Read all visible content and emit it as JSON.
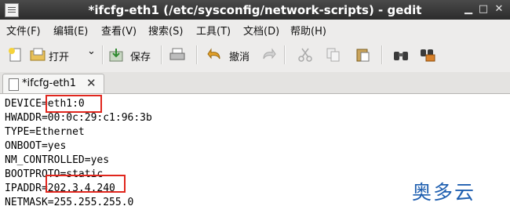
{
  "window": {
    "title": "*ifcfg-eth1 (/etc/sysconfig/network-scripts) - gedit",
    "minimize_glyph": "▁",
    "maximize_glyph": "□",
    "close_glyph": "✕"
  },
  "menu": {
    "items": [
      "文件(F)",
      "编辑(E)",
      "查看(V)",
      "搜索(S)",
      "工具(T)",
      "文档(D)",
      "帮助(H)"
    ]
  },
  "toolbar": {
    "open_label": "打开",
    "dropdown_glyph": "⌄",
    "save_label": "保存",
    "undo_label": "撤消",
    "icons": [
      "new-document-icon",
      "open-folder-icon",
      "save-icon",
      "print-icon",
      "undo-icon",
      "redo-icon",
      "cut-icon",
      "copy-icon",
      "paste-icon",
      "find-icon",
      "find-replace-icon"
    ]
  },
  "tab": {
    "label": "*ifcfg-eth1",
    "close_glyph": "✕"
  },
  "editor": {
    "lines": [
      "DEVICE=eth1:0",
      "HWADDR=00:0c:29:c1:96:3b",
      "TYPE=Ethernet",
      "ONBOOT=yes",
      "NM_CONTROLLED=yes",
      "BOOTPROTO=static",
      "IPADDR=202.3.4.240",
      "NETMASK=255.255.255.0"
    ]
  },
  "watermark": "奥多云",
  "colors": {
    "highlight": "#e0261d",
    "titlebar": "#3a3a3a",
    "watermark": "#1f5fb0"
  }
}
